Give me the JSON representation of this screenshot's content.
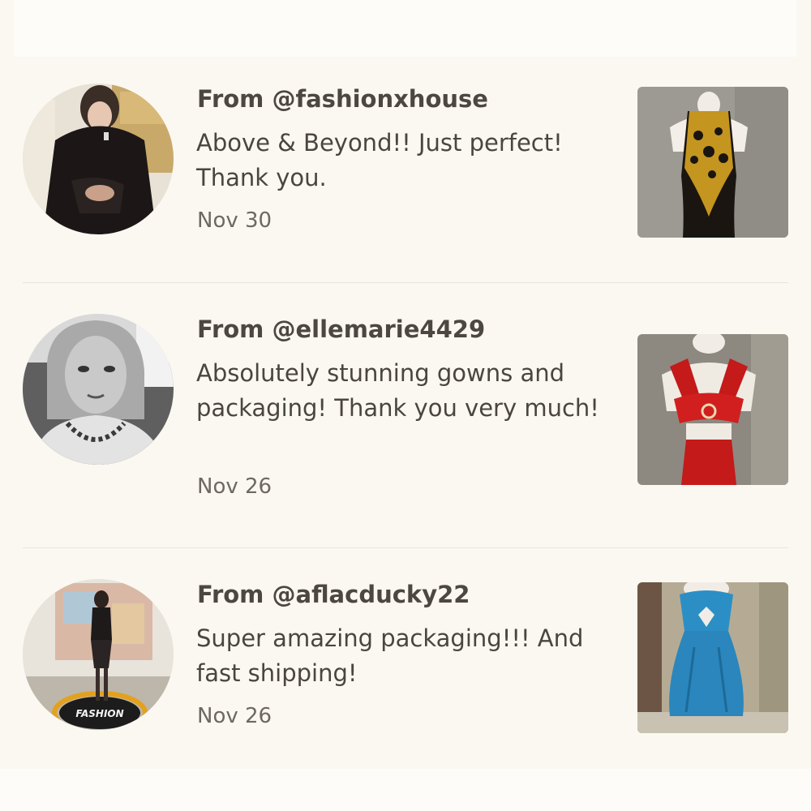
{
  "reviews": [
    {
      "from": "From @fashionxhouse",
      "message": "Above & Beyond!! Just perfect! Thank you.",
      "date": "Nov 30",
      "avatar_icon": "avatar-woman-fur-coat",
      "product_icon": "gold-beaded-gown"
    },
    {
      "from": "From @ellemarie4429",
      "message": "Absolutely stunning gowns and packaging! Thank you very much!",
      "date": "Nov 26",
      "avatar_icon": "avatar-woman-selfie",
      "product_icon": "red-bow-gown"
    },
    {
      "from": "From @aflacducky22",
      "message": "Super amazing packaging!!! And fast shipping!",
      "date": "Nov 26",
      "avatar_icon": "avatar-woman-fashion-stage",
      "product_icon": "blue-strapless-dress"
    }
  ],
  "avatar_stage_text": "FASHION",
  "colors": {
    "background": "#fbf8f1",
    "text": "#4a4540",
    "muted": "#6d6862",
    "divider": "#e9e4db"
  }
}
